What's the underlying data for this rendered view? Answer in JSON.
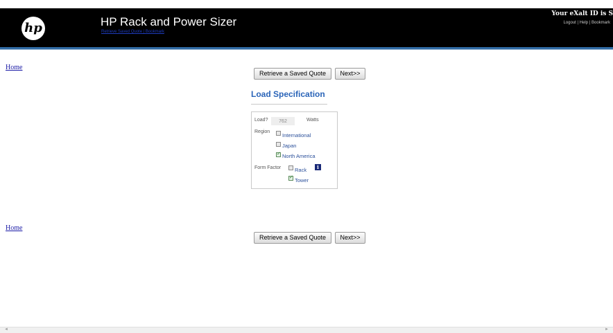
{
  "header": {
    "logo_text": "hp",
    "title": "HP Rack and Power Sizer",
    "sublink": "Retrieve Saved Quote | Bookmark",
    "user_id": "Your eXalt ID is S",
    "links": [
      "Logout",
      "Help",
      "Bookmark"
    ],
    "link_separator": " | "
  },
  "nav": {
    "home": "Home"
  },
  "buttons": {
    "retrieve": "Retrieve a Saved Quote",
    "next": "Next>>"
  },
  "section": {
    "title": "Load Specification"
  },
  "form": {
    "load": {
      "label": "Load?",
      "value": "762",
      "unit": "Watts"
    },
    "region": {
      "label": "Region",
      "options": [
        {
          "label": "International",
          "checked": false
        },
        {
          "label": "Japan",
          "checked": false
        },
        {
          "label": "North America",
          "checked": true
        }
      ]
    },
    "form_factor": {
      "label": "Form Factor",
      "info_icon": "i",
      "options": [
        {
          "label": "Rack",
          "checked": false
        },
        {
          "label": "Tower",
          "checked": true
        }
      ]
    }
  },
  "scrollbar": {
    "left_icon": "◄",
    "right_icon": "►"
  },
  "colors": {
    "header_bg": "#000000",
    "accent_blue": "#2a64b8",
    "link_blue": "#1a1aa6",
    "stripe": "#2f6aa3"
  }
}
